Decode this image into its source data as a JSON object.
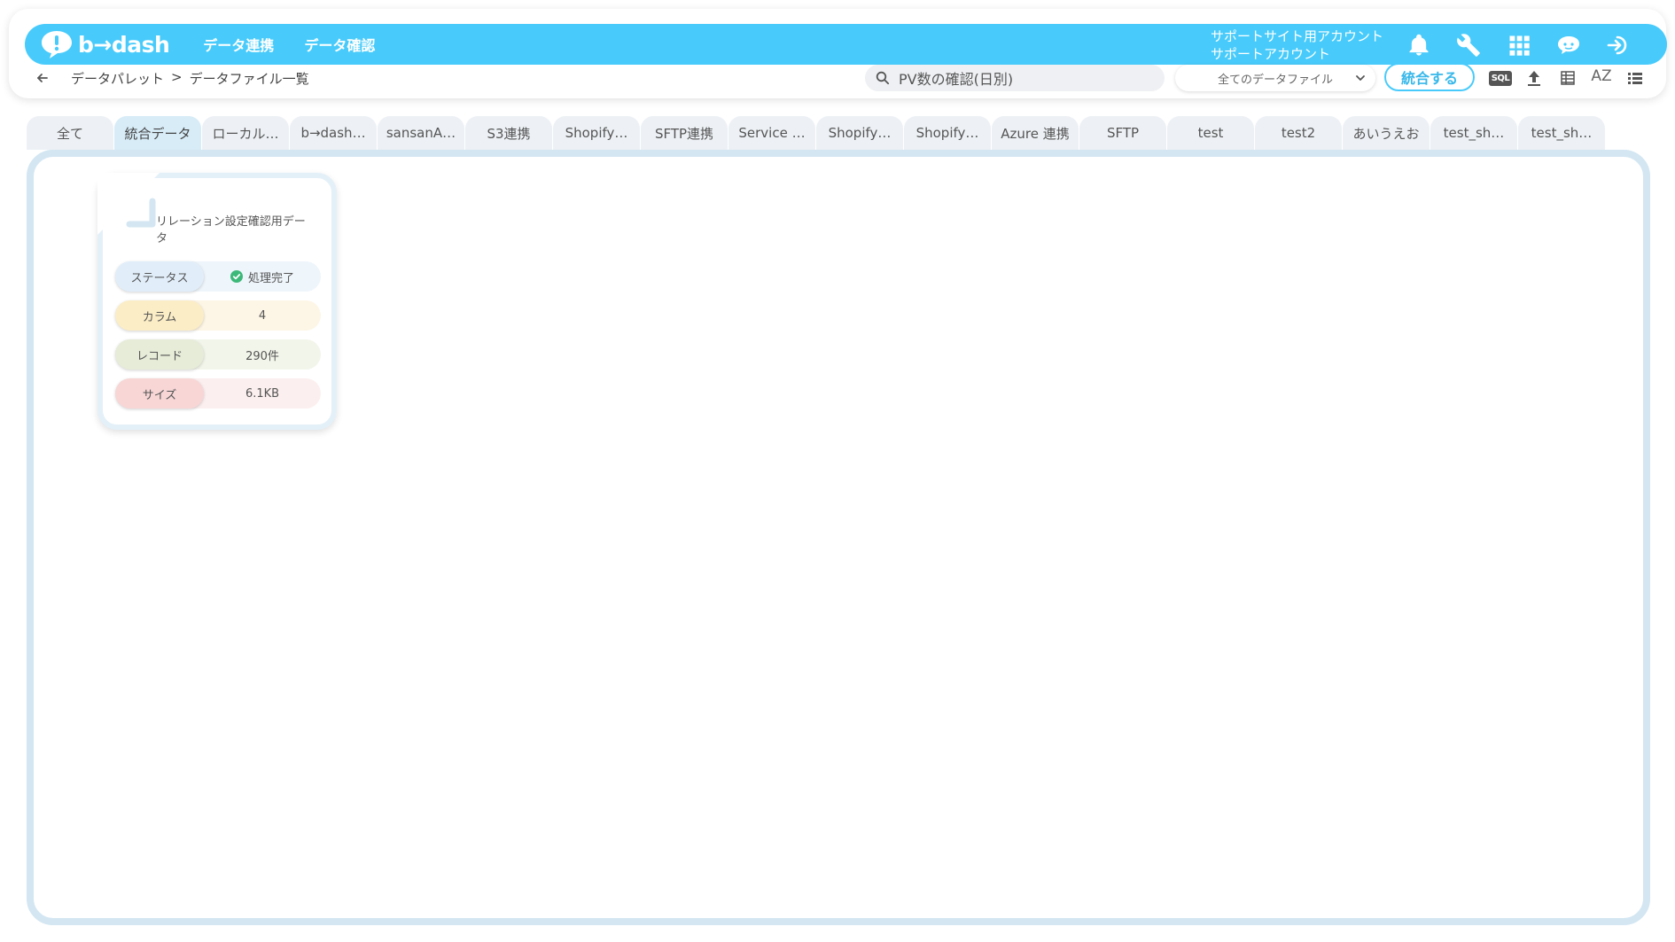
{
  "header": {
    "logo_text": "b→dash",
    "nav": [
      "データ連携",
      "データ確認"
    ],
    "account_line1": "サポートサイト用アカウント",
    "account_line2": "サポートアカウント",
    "icons": [
      "bell-icon",
      "wrench-icon",
      "grid-icon",
      "chat-bot-icon",
      "logout-icon"
    ],
    "accent_color": "#48cbfb"
  },
  "toolbar": {
    "breadcrumb": [
      "データパレット",
      ">",
      "データファイル一覧"
    ],
    "search_value": "PV数の確認(日別)",
    "select_value": "全てのデータファイル",
    "merge_label": "統合する",
    "sql_label": "SQL",
    "sort_label": "AZ"
  },
  "tabs": [
    "全て",
    "統合データ",
    "ローカル…",
    "b→dash…",
    "sansanA…",
    "S3連携",
    "Shopify…",
    "SFTP連携",
    "Service …",
    "Shopify…",
    "Shopify…",
    "Azure 連携",
    "SFTP",
    "test",
    "test2",
    "あいうえお",
    "test_sh…",
    "test_sh…"
  ],
  "active_tab": "統合データ",
  "file_card": {
    "title": "リレーション設定確認用データ",
    "status_label": "ステータス",
    "status_value": "処理完了",
    "column_label": "カラム",
    "column_value": "4",
    "record_label": "レコード",
    "record_value": "290件",
    "size_label": "サイズ",
    "size_value": "6.1KB",
    "status_color": "#3cb878"
  }
}
